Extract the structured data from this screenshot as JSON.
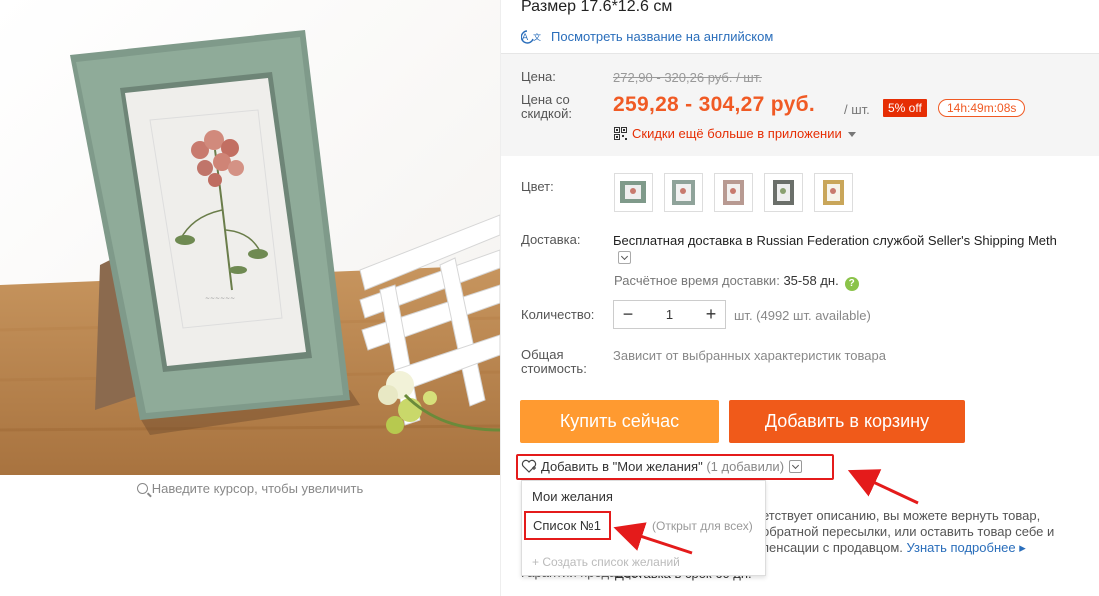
{
  "product": {
    "title": "Размер 17.6*12.6 см",
    "translate_link": "Посмотреть название на английском"
  },
  "gallery": {
    "zoom_hint": "Наведите курсор, чтобы увеличить"
  },
  "price": {
    "label": "Цена:",
    "old_price": "272,90 - 320,26 руб. / шт.",
    "discount_label": "Цена со скидкой:",
    "discount_price": "259,28 - 304,27 руб.",
    "per_unit": "/ шт.",
    "discount_badge": "5% off",
    "timer": "14h:49m:08s",
    "app_promo": "Скидки ещё больше в приложении"
  },
  "color": {
    "label": "Цвет:",
    "swatches": [
      "frame-green",
      "frame-gray-green",
      "frame-pink",
      "frame-dark",
      "frame-gold"
    ]
  },
  "shipping": {
    "label": "Доставка:",
    "text": "Бесплатная доставка в Russian Federation службой Seller's Shipping Meth",
    "eta_label": "Расчётное время доставки:",
    "eta_value": "35-58 дн.",
    "help": "?"
  },
  "quantity": {
    "label": "Количество:",
    "value": "1",
    "minus": "−",
    "plus": "+",
    "available": "шт. (4992 шт. available)"
  },
  "total": {
    "label": "Общая стоимость:",
    "note": "Зависит от выбранных характеристик товара"
  },
  "actions": {
    "buy_now": "Купить сейчас",
    "add_to_cart": "Добавить в корзину"
  },
  "wishlist": {
    "label": "Добавить в \"Мои желания\"",
    "count": "(1 добавили)",
    "dropdown": {
      "header": "Мои желания",
      "list_name": "Список №1",
      "list_status": "(Открыт для всех)",
      "create": "+ Создать список желаний"
    }
  },
  "returns": {
    "text": "етствует описанию, вы можете вернуть товар, обратной пересылки, или оставить товар себе и пенсации с продавцом.",
    "more": "Узнать подробнее ▸"
  },
  "guarantee": {
    "label": "Гарантии продавца:",
    "text": "Доставка в срок 60 дн."
  },
  "colors": {
    "accent": "#f05a24",
    "buy_now": "#ff9a30",
    "add_cart": "#f05a1a",
    "highlight": "#e41b1b",
    "link": "#2a6ebb"
  }
}
